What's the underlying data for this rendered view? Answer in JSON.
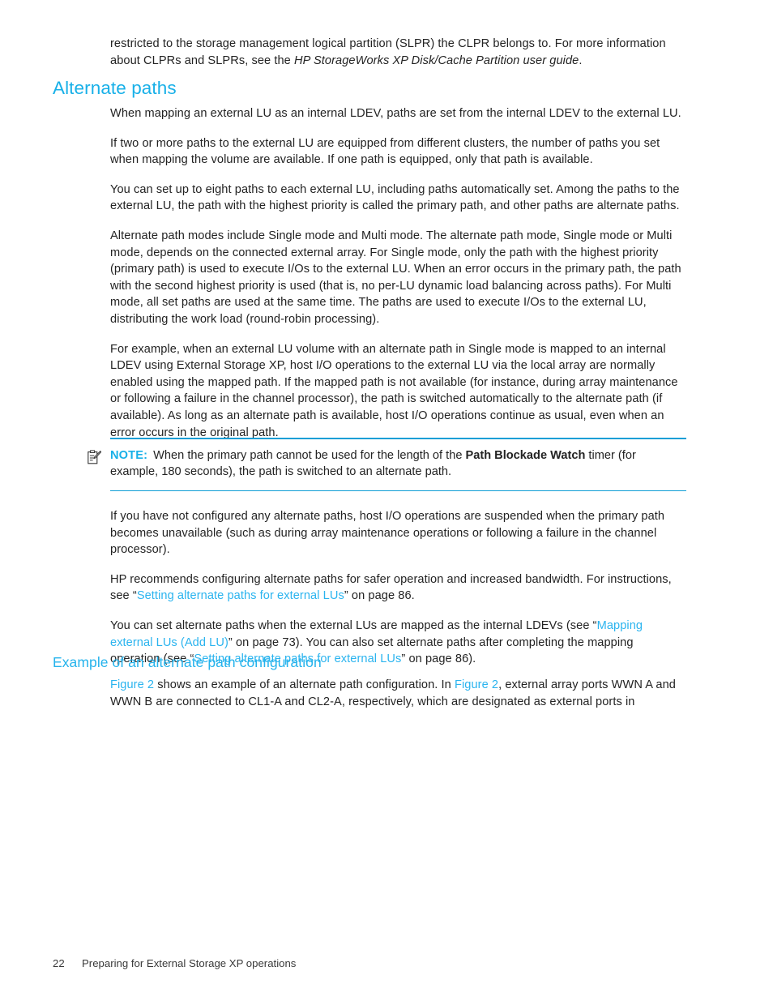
{
  "document": {
    "top_paragraph": {
      "lead": "restricted to the storage management logical partition (SLPR) the CLPR belongs to. For more information about CLPRs and SLPRs, see the ",
      "italic_title": "HP StorageWorks XP Disk/Cache Partition user guide",
      "tail": "."
    },
    "heading_main": "Alternate paths",
    "paragraphs": [
      "When mapping an external LU as an internal LDEV, paths are set from the internal LDEV to the external LU.",
      "If two or more paths to the external LU are equipped from different clusters, the number of paths you set when mapping the volume are available. If one path is equipped, only that path is available.",
      "You can set up to eight paths to each external LU, including paths automatically set. Among the paths to the external LU, the path with the highest priority is called the primary path, and other paths are alternate paths.",
      "Alternate path modes include Single mode and Multi mode. The alternate path mode, Single mode or Multi mode, depends on the connected external array. For Single mode, only the path with the highest priority (primary path) is used to execute I/Os to the external LU. When an error occurs in the primary path, the path with the second highest priority is used (that is, no per-LU dynamic load balancing across paths). For Multi mode, all set paths are used at the same time. The paths are used to execute I/Os to the external LU, distributing the work load (round-robin processing).",
      "For example, when an external LU volume with an alternate path in Single mode is mapped to an internal LDEV using External Storage XP, host I/O operations to the external LU via the local array are normally enabled using the mapped path. If the mapped path is not available (for instance, during array maintenance or following a failure in the channel processor), the path is switched automatically to the alternate path (if available). As long as an alternate path is available, host I/O operations continue as usual, even when an error occurs in the original path."
    ],
    "note": {
      "icon": "note-pencil-icon",
      "label": "NOTE:",
      "text_before_bold": "When the primary path cannot be used for the length of the ",
      "bold_term": "Path Blockade Watch",
      "text_after_bold": " timer (for example, 180 seconds), the path is switched to an alternate path."
    },
    "paragraphs_after_note": [
      "If you have not configured any alternate paths, host I/O operations are suspended when the primary path becomes unavailable (such as during array maintenance operations or following a failure in the channel processor).",
      {
        "segments": [
          {
            "type": "text",
            "value": "HP recommends configuring alternate paths for safer operation and increased bandwidth. For instructions, see “"
          },
          {
            "type": "link",
            "value": "Setting alternate paths for external LUs"
          },
          {
            "type": "text",
            "value": "” on page 86."
          }
        ]
      },
      {
        "segments": [
          {
            "type": "text",
            "value": "You can set alternate paths when the external LUs are mapped as the internal LDEVs (see “"
          },
          {
            "type": "link",
            "value": "Mapping external LUs (Add LU)"
          },
          {
            "type": "text",
            "value": "” on page 73). You can also set alternate paths after completing the mapping operation (see “"
          },
          {
            "type": "link",
            "value": "Setting alternate paths for external LUs"
          },
          {
            "type": "text",
            "value": "” on page 86)."
          }
        ]
      }
    ],
    "heading_sub": "Example of an alternate path configuration",
    "final_paragraph": {
      "segments": [
        {
          "type": "link",
          "value": "Figure 2"
        },
        {
          "type": "text",
          "value": " shows an example of an alternate path configuration. In "
        },
        {
          "type": "link",
          "value": "Figure 2"
        },
        {
          "type": "text",
          "value": ", external array ports WWN A and WWN B are connected to CL1-A and CL2-A, respectively, which are designated as external ports in"
        }
      ]
    },
    "footer": {
      "page_number": "22",
      "chapter_title": "Preparing for External Storage XP operations"
    },
    "colors": {
      "heading": "#18b0e8",
      "subheading": "#25b3ec",
      "link": "#2bb4ef",
      "rule": "#0f9ed6",
      "body_text": "#232323"
    }
  }
}
